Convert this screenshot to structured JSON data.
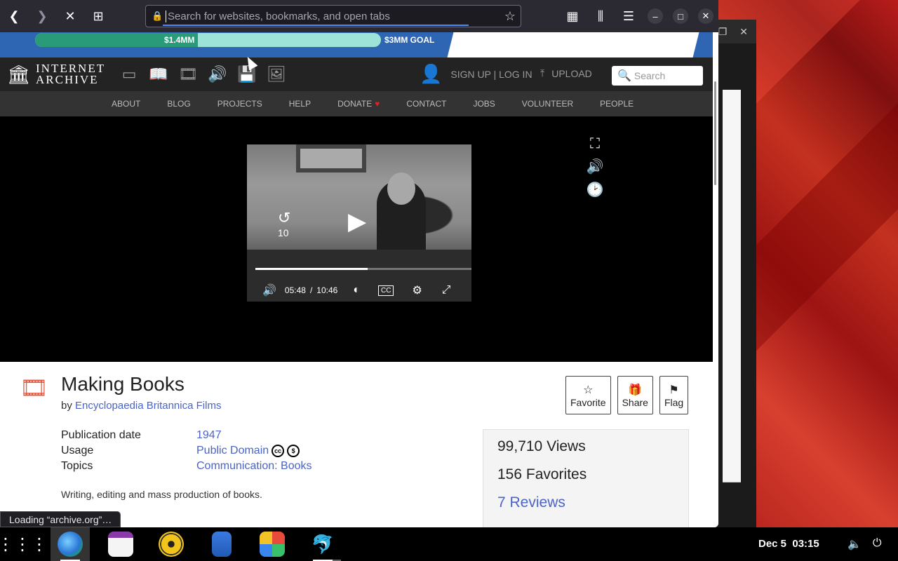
{
  "browser": {
    "url_placeholder": "Search for websites, bookmarks, and open tabs",
    "status_text": "Loading “archive.org”…"
  },
  "banner": {
    "raised": "$1.4MM",
    "goal": "$3MM GOAL",
    "progress_fraction": 0.47
  },
  "ia": {
    "logo_line1": "INTERNET",
    "logo_line2": "ARCHIVE",
    "signup": "SIGN UP | LOG IN",
    "upload": "UPLOAD",
    "search_placeholder": "Search",
    "nav": [
      "ABOUT",
      "BLOG",
      "PROJECTS",
      "HELP",
      "DONATE",
      "CONTACT",
      "JOBS",
      "VOLUNTEER",
      "PEOPLE"
    ]
  },
  "player": {
    "rewind_label": "10",
    "current_time": "05:48",
    "separator": "/",
    "duration": "10:46",
    "progress_fraction": 0.52
  },
  "item": {
    "title": "Making Books",
    "by_prefix": "by",
    "creator": "Encyclopaedia Britannica Films",
    "facts": [
      {
        "key": "Publication date",
        "value": "1947"
      },
      {
        "key": "Usage",
        "value": "Public Domain"
      },
      {
        "key": "Topics",
        "value": "Communication: Books"
      }
    ],
    "description": "Writing, editing and mass production of books.",
    "actions": [
      "Favorite",
      "Share",
      "Flag"
    ],
    "stats": {
      "views": "99,710 Views",
      "favorites": "156 Favorites",
      "reviews": "7 Reviews"
    }
  },
  "taskbar": {
    "clock": "Dec 5  03:15"
  },
  "colors": {
    "link": "#4b64c6",
    "banner_blue": "#2f66b3",
    "banner_fill": "#2a9b78",
    "banner_track": "#9ee3d8"
  }
}
